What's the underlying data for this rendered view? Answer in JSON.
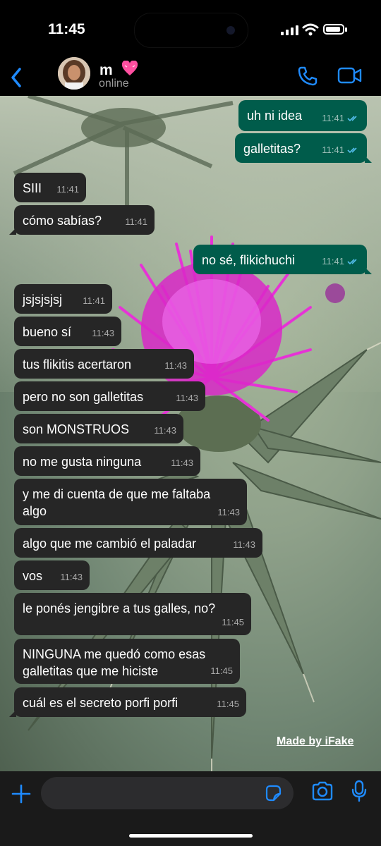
{
  "status_bar": {
    "time": "11:45"
  },
  "header": {
    "name": "m",
    "status": "online",
    "accent": "#1f8bff"
  },
  "messages": [
    {
      "dir": "out",
      "text": "uh ni idea",
      "time": "11:41"
    },
    {
      "dir": "out",
      "text": "galletitas?",
      "time": "11:41"
    },
    {
      "dir": "in",
      "text": "SIII",
      "time": "11:41"
    },
    {
      "dir": "in",
      "text": "cómo sabías?",
      "time": "11:41"
    },
    {
      "dir": "out",
      "text": "no sé, flikichuchi",
      "time": "11:41"
    },
    {
      "dir": "in",
      "text": "jsjsjsjsj",
      "time": "11:41"
    },
    {
      "dir": "in",
      "text": "bueno sí",
      "time": "11:43"
    },
    {
      "dir": "in",
      "text": "tus flikitis acertaron",
      "time": "11:43"
    },
    {
      "dir": "in",
      "text": "pero no son galletitas",
      "time": "11:43"
    },
    {
      "dir": "in",
      "text": "son MONSTRUOS",
      "time": "11:43"
    },
    {
      "dir": "in",
      "text": "no me gusta ninguna",
      "time": "11:43"
    },
    {
      "dir": "in",
      "text_lines": [
        "y me di cuenta de que me faltaba",
        "algo"
      ],
      "time": "11:43"
    },
    {
      "dir": "in",
      "text": "algo que me cambió el paladar",
      "time": "11:43"
    },
    {
      "dir": "in",
      "text": "vos",
      "time": "11:43"
    },
    {
      "dir": "in",
      "text": "le ponés jengibre a tus galles, no?",
      "time": "11:45"
    },
    {
      "dir": "in",
      "text_lines": [
        "NINGUNA me quedó como esas",
        "galletitas que me hiciste"
      ],
      "time": "11:45"
    },
    {
      "dir": "in",
      "text": "cuál es el secreto porfi porfi",
      "time": "11:45"
    }
  ],
  "watermark": "Made by iFake",
  "colors": {
    "incoming_bubble": "#262626",
    "outgoing_bubble": "#005c4b",
    "read_ticks": "#53bdeb"
  },
  "icons": {
    "back": "chevron-left-icon",
    "call": "phone-icon",
    "video": "video-camera-icon",
    "plus": "plus-icon",
    "sticker": "sticker-icon",
    "camera": "camera-icon",
    "mic": "microphone-icon"
  }
}
